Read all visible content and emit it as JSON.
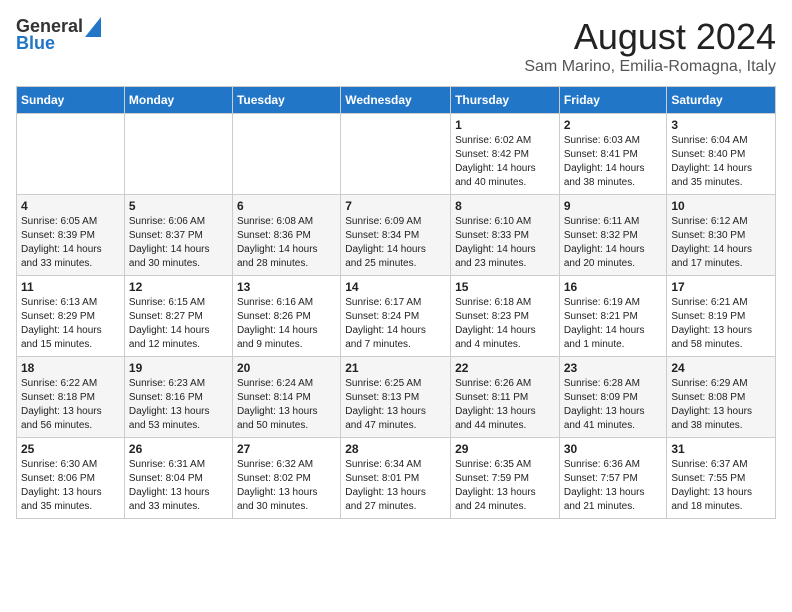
{
  "header": {
    "logo_line1": "General",
    "logo_line2": "Blue",
    "title": "August 2024",
    "subtitle": "Sam Marino, Emilia-Romagna, Italy"
  },
  "days_of_week": [
    "Sunday",
    "Monday",
    "Tuesday",
    "Wednesday",
    "Thursday",
    "Friday",
    "Saturday"
  ],
  "weeks": [
    [
      {
        "day": "",
        "content": ""
      },
      {
        "day": "",
        "content": ""
      },
      {
        "day": "",
        "content": ""
      },
      {
        "day": "",
        "content": ""
      },
      {
        "day": "1",
        "content": "Sunrise: 6:02 AM\nSunset: 8:42 PM\nDaylight: 14 hours\nand 40 minutes."
      },
      {
        "day": "2",
        "content": "Sunrise: 6:03 AM\nSunset: 8:41 PM\nDaylight: 14 hours\nand 38 minutes."
      },
      {
        "day": "3",
        "content": "Sunrise: 6:04 AM\nSunset: 8:40 PM\nDaylight: 14 hours\nand 35 minutes."
      }
    ],
    [
      {
        "day": "4",
        "content": "Sunrise: 6:05 AM\nSunset: 8:39 PM\nDaylight: 14 hours\nand 33 minutes."
      },
      {
        "day": "5",
        "content": "Sunrise: 6:06 AM\nSunset: 8:37 PM\nDaylight: 14 hours\nand 30 minutes."
      },
      {
        "day": "6",
        "content": "Sunrise: 6:08 AM\nSunset: 8:36 PM\nDaylight: 14 hours\nand 28 minutes."
      },
      {
        "day": "7",
        "content": "Sunrise: 6:09 AM\nSunset: 8:34 PM\nDaylight: 14 hours\nand 25 minutes."
      },
      {
        "day": "8",
        "content": "Sunrise: 6:10 AM\nSunset: 8:33 PM\nDaylight: 14 hours\nand 23 minutes."
      },
      {
        "day": "9",
        "content": "Sunrise: 6:11 AM\nSunset: 8:32 PM\nDaylight: 14 hours\nand 20 minutes."
      },
      {
        "day": "10",
        "content": "Sunrise: 6:12 AM\nSunset: 8:30 PM\nDaylight: 14 hours\nand 17 minutes."
      }
    ],
    [
      {
        "day": "11",
        "content": "Sunrise: 6:13 AM\nSunset: 8:29 PM\nDaylight: 14 hours\nand 15 minutes."
      },
      {
        "day": "12",
        "content": "Sunrise: 6:15 AM\nSunset: 8:27 PM\nDaylight: 14 hours\nand 12 minutes."
      },
      {
        "day": "13",
        "content": "Sunrise: 6:16 AM\nSunset: 8:26 PM\nDaylight: 14 hours\nand 9 minutes."
      },
      {
        "day": "14",
        "content": "Sunrise: 6:17 AM\nSunset: 8:24 PM\nDaylight: 14 hours\nand 7 minutes."
      },
      {
        "day": "15",
        "content": "Sunrise: 6:18 AM\nSunset: 8:23 PM\nDaylight: 14 hours\nand 4 minutes."
      },
      {
        "day": "16",
        "content": "Sunrise: 6:19 AM\nSunset: 8:21 PM\nDaylight: 14 hours\nand 1 minute."
      },
      {
        "day": "17",
        "content": "Sunrise: 6:21 AM\nSunset: 8:19 PM\nDaylight: 13 hours\nand 58 minutes."
      }
    ],
    [
      {
        "day": "18",
        "content": "Sunrise: 6:22 AM\nSunset: 8:18 PM\nDaylight: 13 hours\nand 56 minutes."
      },
      {
        "day": "19",
        "content": "Sunrise: 6:23 AM\nSunset: 8:16 PM\nDaylight: 13 hours\nand 53 minutes."
      },
      {
        "day": "20",
        "content": "Sunrise: 6:24 AM\nSunset: 8:14 PM\nDaylight: 13 hours\nand 50 minutes."
      },
      {
        "day": "21",
        "content": "Sunrise: 6:25 AM\nSunset: 8:13 PM\nDaylight: 13 hours\nand 47 minutes."
      },
      {
        "day": "22",
        "content": "Sunrise: 6:26 AM\nSunset: 8:11 PM\nDaylight: 13 hours\nand 44 minutes."
      },
      {
        "day": "23",
        "content": "Sunrise: 6:28 AM\nSunset: 8:09 PM\nDaylight: 13 hours\nand 41 minutes."
      },
      {
        "day": "24",
        "content": "Sunrise: 6:29 AM\nSunset: 8:08 PM\nDaylight: 13 hours\nand 38 minutes."
      }
    ],
    [
      {
        "day": "25",
        "content": "Sunrise: 6:30 AM\nSunset: 8:06 PM\nDaylight: 13 hours\nand 35 minutes."
      },
      {
        "day": "26",
        "content": "Sunrise: 6:31 AM\nSunset: 8:04 PM\nDaylight: 13 hours\nand 33 minutes."
      },
      {
        "day": "27",
        "content": "Sunrise: 6:32 AM\nSunset: 8:02 PM\nDaylight: 13 hours\nand 30 minutes."
      },
      {
        "day": "28",
        "content": "Sunrise: 6:34 AM\nSunset: 8:01 PM\nDaylight: 13 hours\nand 27 minutes."
      },
      {
        "day": "29",
        "content": "Sunrise: 6:35 AM\nSunset: 7:59 PM\nDaylight: 13 hours\nand 24 minutes."
      },
      {
        "day": "30",
        "content": "Sunrise: 6:36 AM\nSunset: 7:57 PM\nDaylight: 13 hours\nand 21 minutes."
      },
      {
        "day": "31",
        "content": "Sunrise: 6:37 AM\nSunset: 7:55 PM\nDaylight: 13 hours\nand 18 minutes."
      }
    ]
  ]
}
